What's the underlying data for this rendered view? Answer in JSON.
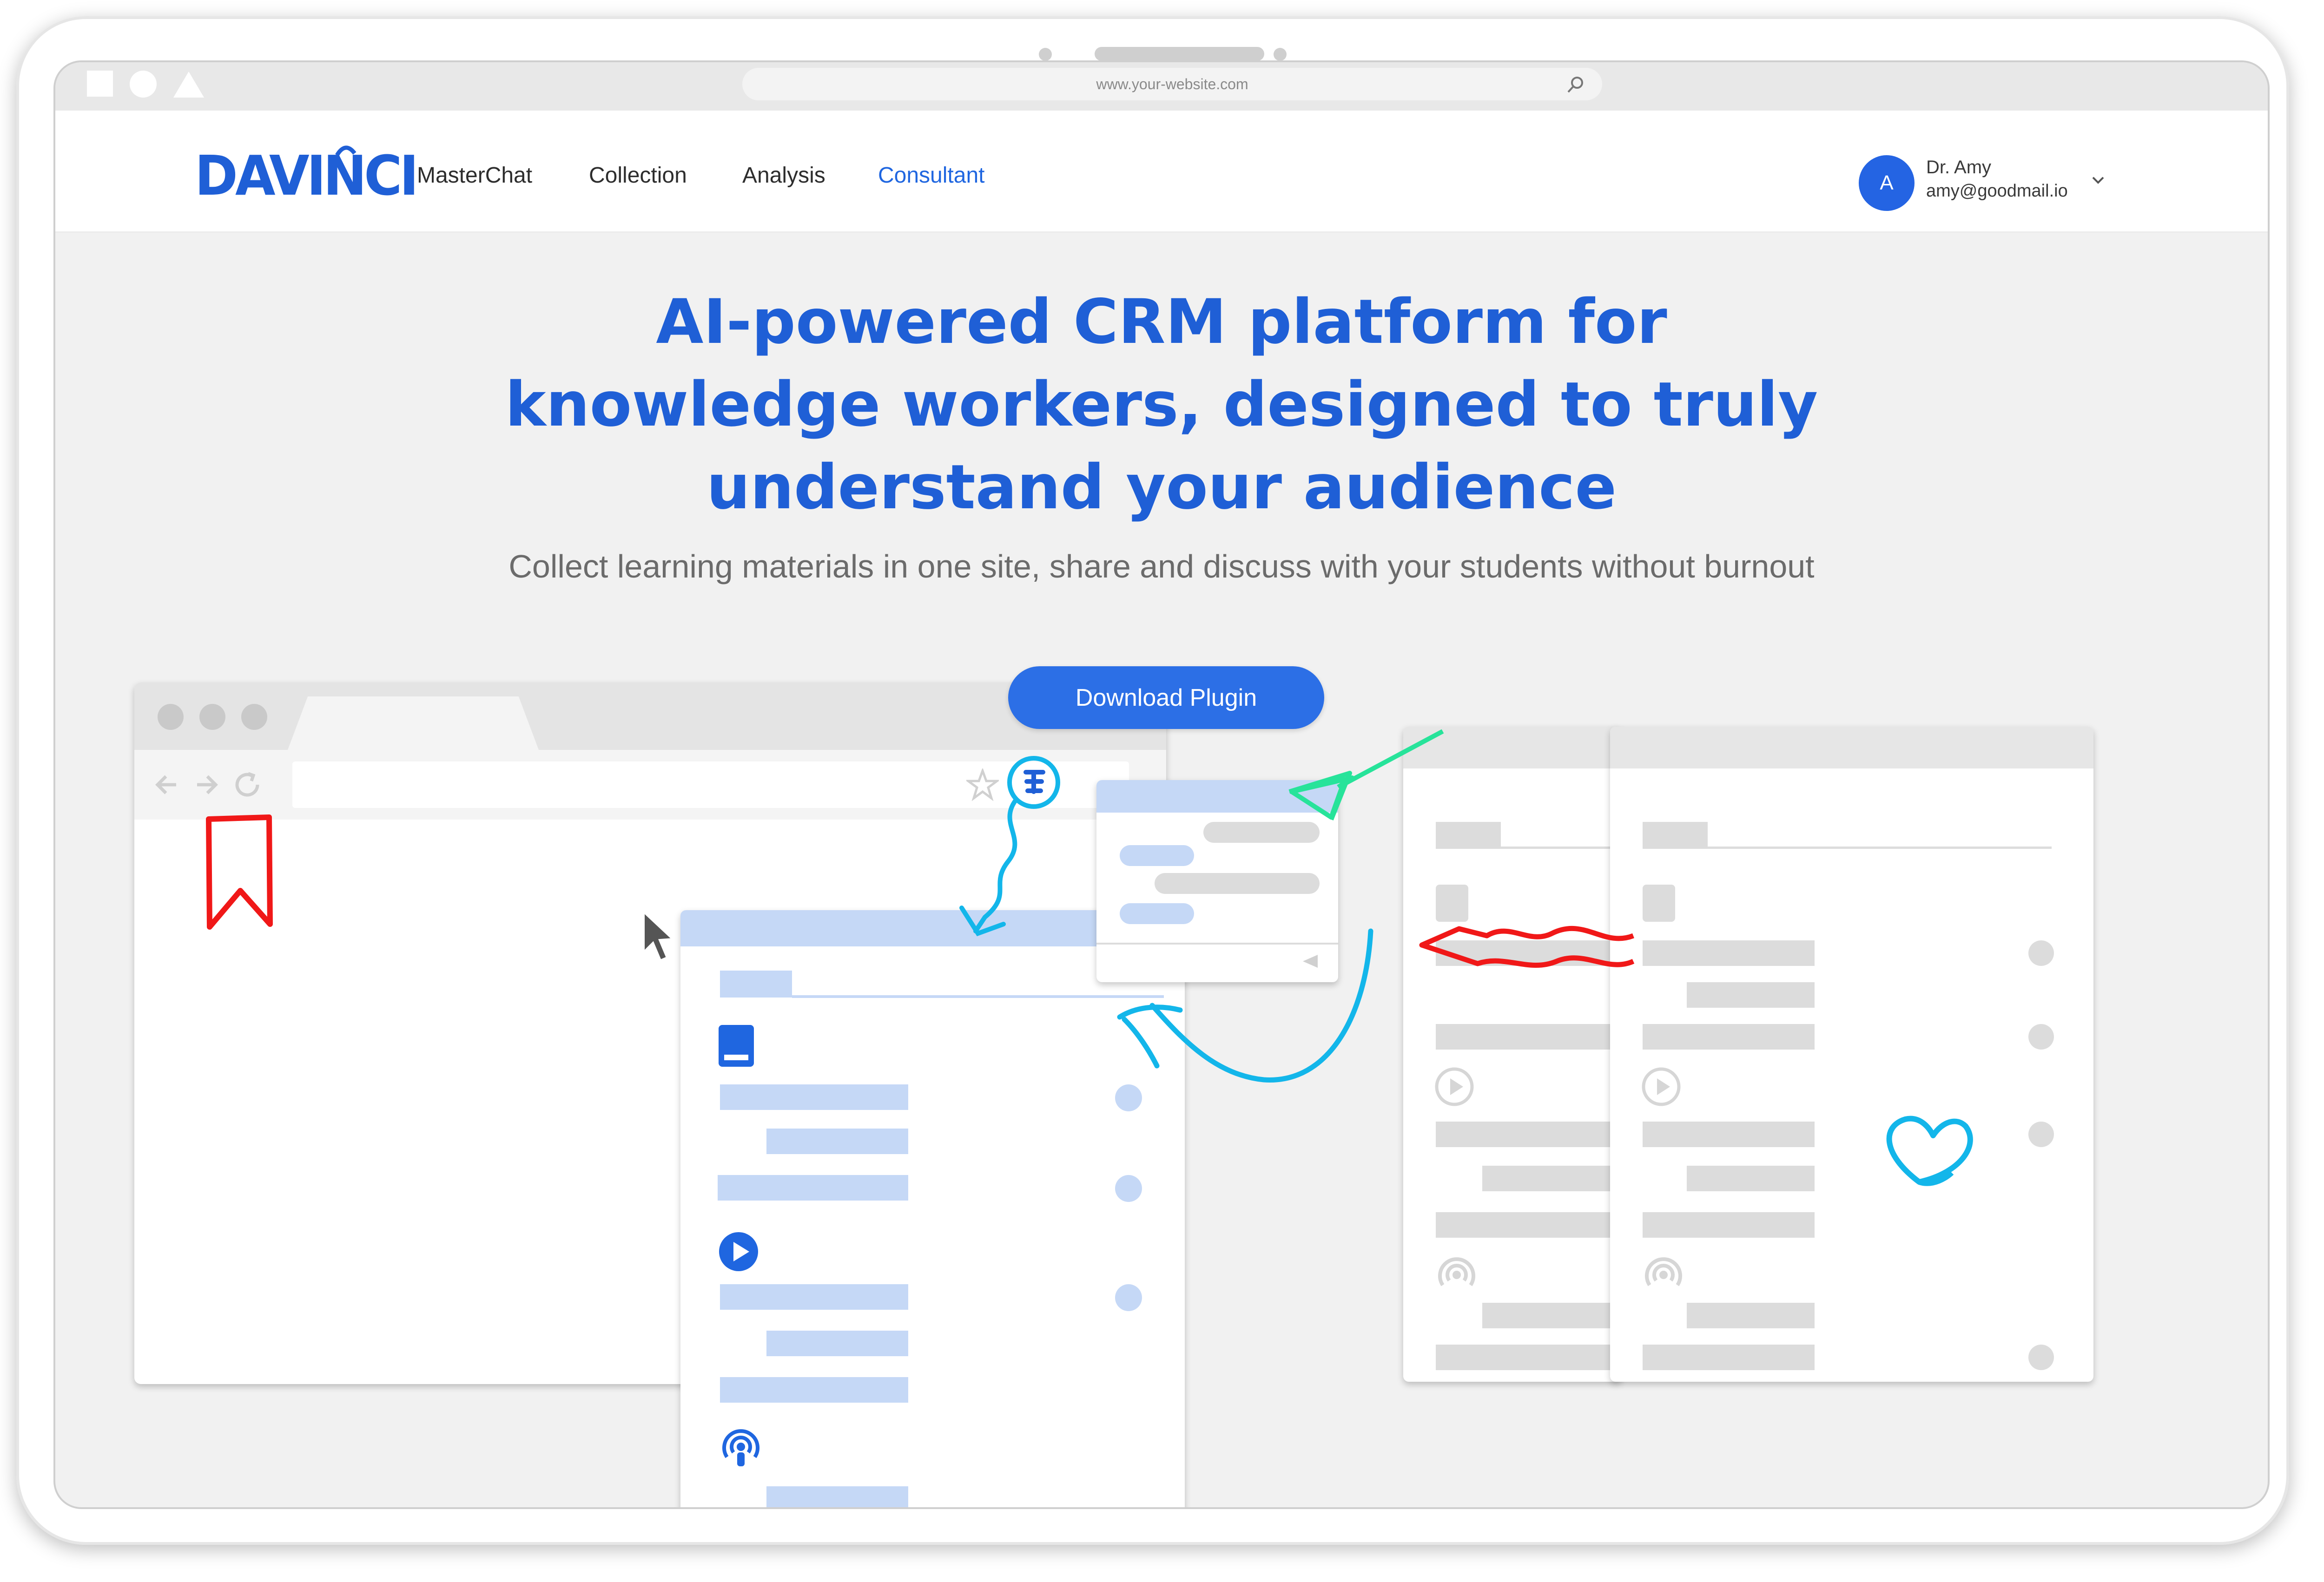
{
  "browser": {
    "url": "www.your-website.com"
  },
  "brand": {
    "logo_text": "DAVINCI"
  },
  "nav": {
    "items": [
      {
        "label": "MasterChat"
      },
      {
        "label": "Collection"
      },
      {
        "label": "Analysis"
      },
      {
        "label": "Consultant",
        "active": true
      }
    ]
  },
  "user": {
    "avatar_letter": "A",
    "name": "Dr. Amy",
    "email": "amy@goodmail.io"
  },
  "hero": {
    "title_lines": [
      "AI-powered CRM platform for",
      "knowledge workers, designed to truly",
      "understand your audience"
    ],
    "subtitle": "Collect learning materials in one site, share and discuss with your students without burnout",
    "cta_label": "Download Plugin"
  },
  "colors": {
    "brand_blue": "#1f5fd6",
    "cta_blue": "#2c6fe6",
    "placeholder_blue": "#c5d8f6",
    "placeholder_grey": "#dcdcdc",
    "scribble_cyan": "#13b6ea",
    "scribble_green": "#27e39a",
    "scribble_red": "#f01818"
  },
  "icons": [
    "search-icon",
    "chevron-down-icon",
    "bookmark-icon",
    "cursor-icon",
    "book-icon",
    "play-icon",
    "podcast-icon",
    "heart-icon",
    "star-icon",
    "back-icon",
    "forward-icon",
    "reload-icon"
  ]
}
